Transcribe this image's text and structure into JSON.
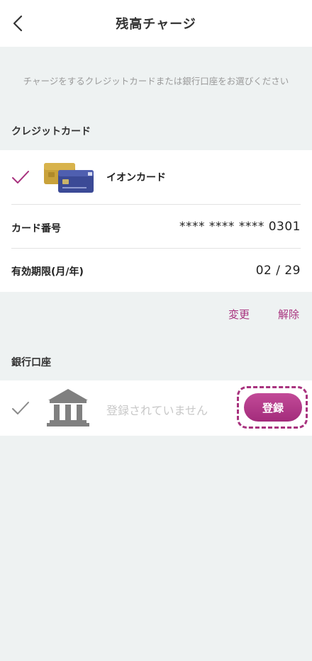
{
  "header": {
    "title": "残高チャージ"
  },
  "instruction": "チャージをするクレジットカードまたは銀行口座をお選びください",
  "credit_section": {
    "label": "クレジットカード",
    "card_name": "イオンカード",
    "card_number_label": "カード番号",
    "card_number_value": "**** **** **** 0301",
    "expiry_label": "有効期限(月/年)",
    "expiry_value": "02 / 29",
    "change_label": "変更",
    "remove_label": "解除",
    "accent_color": "#a8327e"
  },
  "bank_section": {
    "label": "銀行口座",
    "status": "登録されていません",
    "register_label": "登録"
  }
}
